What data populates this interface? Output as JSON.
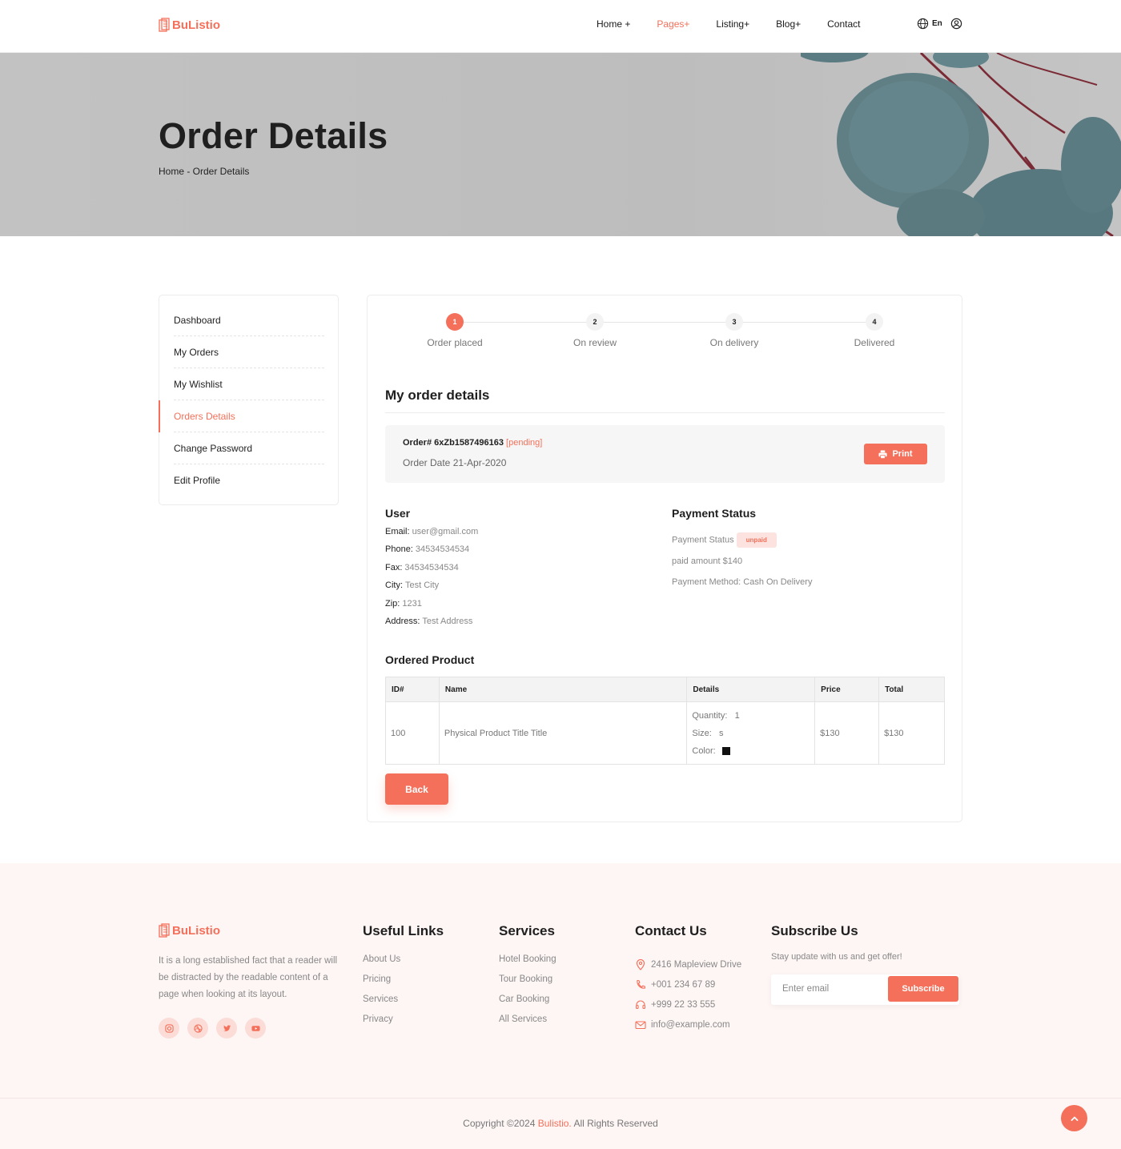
{
  "brand": {
    "name": "BuListio",
    "accent": "#f4705a"
  },
  "nav": {
    "items": [
      {
        "label": "Home +"
      },
      {
        "label": "Pages+"
      },
      {
        "label": "Listing+"
      },
      {
        "label": "Blog+"
      },
      {
        "label": "Contact"
      }
    ],
    "active": "Pages+",
    "lang": "En",
    "icons": [
      "globe-icon",
      "user-circle-icon"
    ]
  },
  "hero": {
    "title": "Order Details",
    "breadcrumb": "Home - Order Details"
  },
  "sidebar": {
    "items": [
      {
        "label": "Dashboard"
      },
      {
        "label": "My Orders"
      },
      {
        "label": "My Wishlist"
      },
      {
        "label": "Orders Details"
      },
      {
        "label": "Change Password"
      },
      {
        "label": "Edit Profile"
      }
    ],
    "active": "Orders Details"
  },
  "steps": [
    {
      "num": "1",
      "label": "Order placed"
    },
    {
      "num": "2",
      "label": "On review"
    },
    {
      "num": "3",
      "label": "On delivery"
    },
    {
      "num": "4",
      "label": "Delivered"
    }
  ],
  "current_step": 1,
  "order": {
    "heading": "My order details",
    "number": "Order# 6xZb1587496163",
    "status": "[pending]",
    "date": "Order Date 21-Apr-2020",
    "print_label": "Print"
  },
  "user": {
    "title": "User",
    "fields": [
      {
        "k": "Email:",
        "v": "user@gmail.com"
      },
      {
        "k": "Phone:",
        "v": "34534534534"
      },
      {
        "k": "Fax:",
        "v": "34534534534"
      },
      {
        "k": "City:",
        "v": "Test City"
      },
      {
        "k": "Zip:",
        "v": "1231"
      },
      {
        "k": "Address:",
        "v": "Test Address"
      }
    ]
  },
  "payment": {
    "title": "Payment Status",
    "status_label": "Payment Status",
    "status_badge": "unpaid",
    "amount": "paid amount $140",
    "method": "Payment Method: Cash On Delivery"
  },
  "products": {
    "title": "Ordered Product",
    "headers": [
      "ID#",
      "Name",
      "Details",
      "Price",
      "Total"
    ],
    "rows": [
      {
        "id": "100",
        "name": "Physical Product Title Title",
        "quantity_label": "Quantity:",
        "quantity": "1",
        "size_label": "Size:",
        "size": "s",
        "color_label": "Color:",
        "color": "#111111",
        "price": "$130",
        "total": "$130"
      }
    ]
  },
  "back_label": "Back",
  "footer": {
    "about": "It is a long established fact that a reader will be distracted by the readable content of a page when looking at its layout.",
    "socials": [
      "instagram-icon",
      "dribbble-icon",
      "twitter-icon",
      "youtube-icon"
    ],
    "useful_title": "Useful Links",
    "useful": [
      "About Us",
      "Pricing",
      "Services",
      "Privacy"
    ],
    "services_title": "Services",
    "services": [
      "Hotel Booking",
      "Tour Booking",
      "Car Booking",
      "All Services"
    ],
    "contact_title": "Contact Us",
    "contact": [
      "2416 Mapleview Drive",
      "+001 234 67 89",
      "+999 22 33 555",
      "info@example.com"
    ],
    "subscribe_title": "Subscribe Us",
    "subscribe_text": "Stay update with us and get offer!",
    "email_placeholder": "Enter email",
    "subscribe_button": "Subscribe",
    "copyright_pre": "Copyright ©2024 ",
    "copyright_brand": "Bulistio.",
    "copyright_post": " All Rights Reserved"
  }
}
